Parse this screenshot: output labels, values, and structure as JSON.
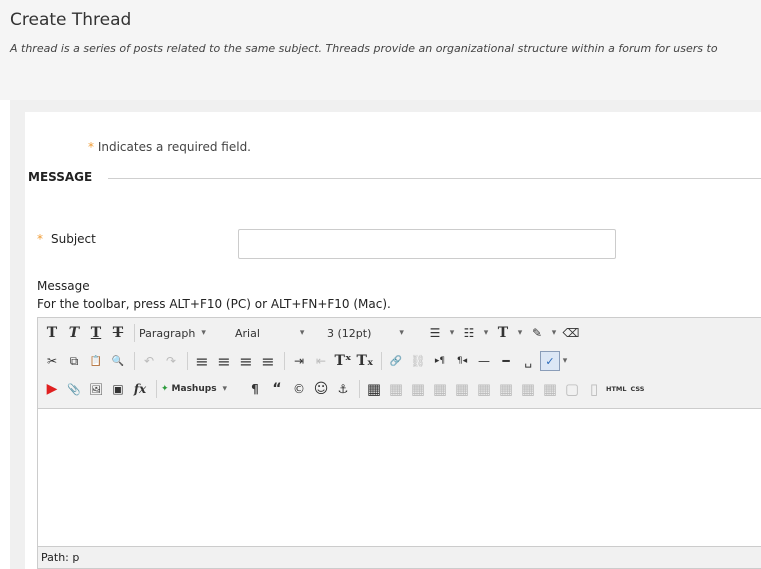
{
  "header": {
    "title": "Create Thread",
    "subtitle": "A thread is a series of posts related to the same subject. Threads provide an organizational structure within a forum for users to"
  },
  "form": {
    "required_note": "Indicates a required field.",
    "required_marker": "*",
    "section_title": "MESSAGE",
    "subject_label": "Subject",
    "subject_value": "",
    "message_label": "Message",
    "toolbar_hint": "For the toolbar, press ALT+F10 (PC) or ALT+FN+F10 (Mac)."
  },
  "editor": {
    "row1": {
      "bold": "T",
      "italic": "T",
      "underline": "T",
      "strike": "T",
      "format": "Paragraph",
      "font": "Arial",
      "size": "3 (12pt)",
      "bullets": "☰",
      "numbers": "☷",
      "text_color": "T",
      "highlight": "✎",
      "eraser": "⌫"
    },
    "row2": {
      "cut": "✂",
      "copy": "⧉",
      "paste": "📋",
      "find": "🔍",
      "undo": "↶",
      "redo": "↷",
      "align_left": "≡",
      "align_center": "≡",
      "align_right": "≡",
      "justify": "≡",
      "indent": "⇥",
      "outdent": "⇤",
      "superscript": "Tˣ",
      "subscript": "Tₓ",
      "link": "🔗",
      "unlink": "⛓",
      "ltr": "▸¶",
      "rtl": "¶◂",
      "hr": "—",
      "hr2": "━",
      "nbsp": "␣",
      "spell": "ABC ✓"
    },
    "row3": {
      "youtube": "▶",
      "attach": "📎",
      "image": "🖼",
      "media": "▣",
      "formula": "fx",
      "mashups": "Mashups",
      "paragraph": "¶",
      "quote": "“",
      "copyright": "©",
      "emoji": "☺",
      "anchor": "⚓",
      "table": "▦",
      "html": "HTML",
      "css": "CSS"
    },
    "path_label": "Path: p"
  },
  "colors": {
    "required": "#f09c35",
    "header_bg": "#f5f5f5",
    "toolbar_bg": "#f1f1f1"
  }
}
